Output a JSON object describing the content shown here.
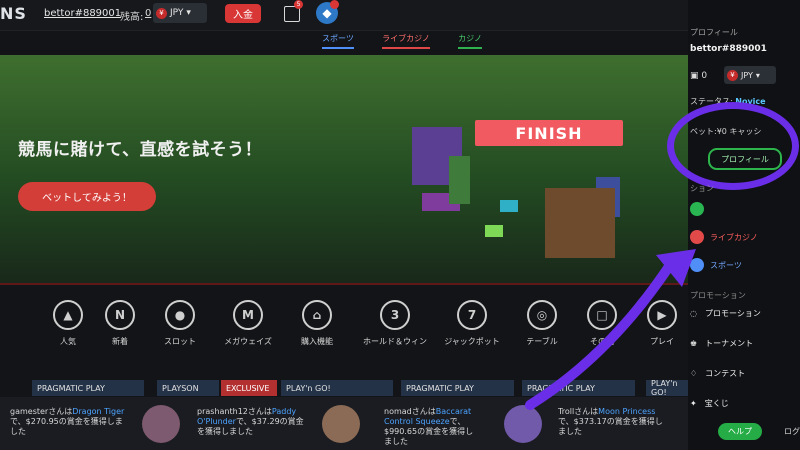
{
  "header": {
    "logo": "NS",
    "username": "bettor#889001",
    "balance_label": "残高:",
    "balance_value": "0",
    "currency_code": "JPY",
    "currency_symbol": "¥",
    "deposit_label": "入金",
    "gift_badge": "5"
  },
  "tabs": [
    "スポーツ",
    "ライブカジノ",
    "カジノ"
  ],
  "hero": {
    "title": "競馬に賭けて、直感を試そう！",
    "cta": "ベットしてみよう！",
    "finish_label": "FINISH"
  },
  "categories": [
    {
      "label": "人気",
      "icon": "mountain-icon"
    },
    {
      "label": "新着",
      "icon": "new-badge-icon"
    },
    {
      "label": "スロット",
      "icon": "cherry-icon"
    },
    {
      "label": "メガウェイズ",
      "icon": "mega-icon"
    },
    {
      "label": "購入機能",
      "icon": "cart-icon"
    },
    {
      "label": "ホールド＆ウィン",
      "icon": "refresh-3-icon"
    },
    {
      "label": "ジャックポット",
      "icon": "seven-icon"
    },
    {
      "label": "テーブル",
      "icon": "chip-icon"
    },
    {
      "label": "その他",
      "icon": "folder-icon"
    },
    {
      "label": "プレイ",
      "icon": "play-icon"
    }
  ],
  "providers": [
    {
      "label": "PRAGMATIC PLAY"
    },
    {
      "label": "PLAYSON"
    },
    {
      "label": "EXCLUSIVE"
    },
    {
      "label": "PLAY'n GO!"
    },
    {
      "label": "PRAGMATIC PLAY"
    },
    {
      "label": "PRAGMATIC PLAY"
    },
    {
      "label": "PLAY'n GO!"
    }
  ],
  "ticker": [
    {
      "user": "gamester",
      "user_suffix": "さんは",
      "game": "Dragon Tiger",
      "amount": "で、$270.95の賞金を獲得しました"
    },
    {
      "user": "prashanth12",
      "user_suffix": "さんは",
      "game": "Paddy O'Plunder",
      "amount": "で、$37.29の賞金を獲得しました"
    },
    {
      "user": "nomad",
      "user_suffix": "さんは",
      "game": "Baccarat Control Squeeze",
      "amount": "で、$990.65の賞金を獲得しました"
    },
    {
      "user": "Troll",
      "user_suffix": "さんは",
      "game": "Moon Princess",
      "amount": "で、$373.17の賞金を獲得しました"
    }
  ],
  "sidebar": {
    "section_title": "プロフィール",
    "username": "bettor#889001",
    "balance_value": "0",
    "currency_code": "JPY",
    "currency_symbol": "¥",
    "status_label": "ステータス:",
    "status_value": "Novice",
    "bet_label": "ベット:",
    "bet_value": "¥0",
    "bet_more": "キャッシ",
    "profile_button": "プロフィール",
    "section_small": "ション",
    "nav_live": "ライブカジノ",
    "nav_sports": "スポーツ",
    "promo_title": "プロモーション",
    "promo_items": [
      "プロモーション",
      "トーナメント",
      "コンテスト",
      "宝くじ"
    ],
    "help_button": "ヘルプ",
    "logout_label": "ログ"
  },
  "colors": {
    "accent_red": "#d93636",
    "accent_green": "#2db54c",
    "accent_blue": "#4f8ff7",
    "annotation_purple": "#6b2ee8"
  }
}
